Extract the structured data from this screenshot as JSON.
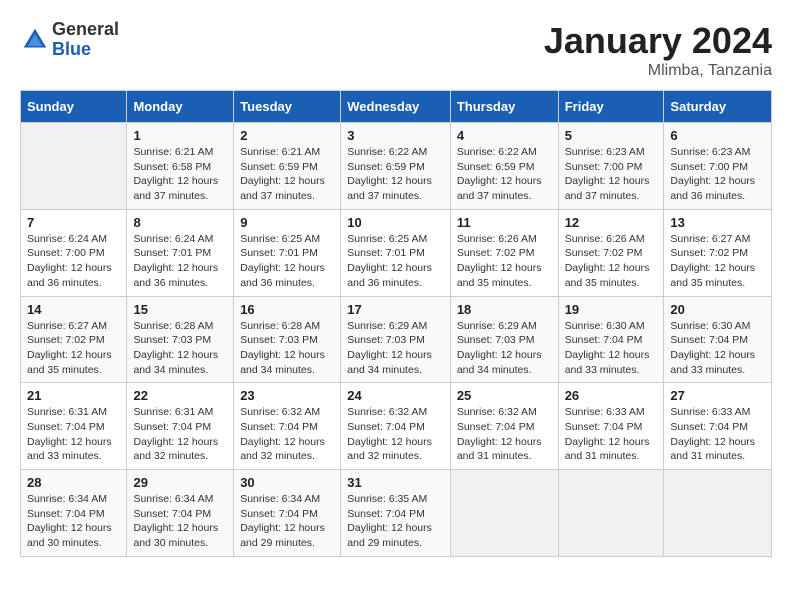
{
  "logo": {
    "general": "General",
    "blue": "Blue"
  },
  "title": {
    "month_year": "January 2024",
    "location": "Mlimba, Tanzania"
  },
  "calendar": {
    "headers": [
      "Sunday",
      "Monday",
      "Tuesday",
      "Wednesday",
      "Thursday",
      "Friday",
      "Saturday"
    ],
    "weeks": [
      [
        {
          "day": "",
          "sunrise": "",
          "sunset": "",
          "daylight": ""
        },
        {
          "day": "1",
          "sunrise": "Sunrise: 6:21 AM",
          "sunset": "Sunset: 6:58 PM",
          "daylight": "Daylight: 12 hours and 37 minutes."
        },
        {
          "day": "2",
          "sunrise": "Sunrise: 6:21 AM",
          "sunset": "Sunset: 6:59 PM",
          "daylight": "Daylight: 12 hours and 37 minutes."
        },
        {
          "day": "3",
          "sunrise": "Sunrise: 6:22 AM",
          "sunset": "Sunset: 6:59 PM",
          "daylight": "Daylight: 12 hours and 37 minutes."
        },
        {
          "day": "4",
          "sunrise": "Sunrise: 6:22 AM",
          "sunset": "Sunset: 6:59 PM",
          "daylight": "Daylight: 12 hours and 37 minutes."
        },
        {
          "day": "5",
          "sunrise": "Sunrise: 6:23 AM",
          "sunset": "Sunset: 7:00 PM",
          "daylight": "Daylight: 12 hours and 37 minutes."
        },
        {
          "day": "6",
          "sunrise": "Sunrise: 6:23 AM",
          "sunset": "Sunset: 7:00 PM",
          "daylight": "Daylight: 12 hours and 36 minutes."
        }
      ],
      [
        {
          "day": "7",
          "sunrise": "Sunrise: 6:24 AM",
          "sunset": "Sunset: 7:00 PM",
          "daylight": "Daylight: 12 hours and 36 minutes."
        },
        {
          "day": "8",
          "sunrise": "Sunrise: 6:24 AM",
          "sunset": "Sunset: 7:01 PM",
          "daylight": "Daylight: 12 hours and 36 minutes."
        },
        {
          "day": "9",
          "sunrise": "Sunrise: 6:25 AM",
          "sunset": "Sunset: 7:01 PM",
          "daylight": "Daylight: 12 hours and 36 minutes."
        },
        {
          "day": "10",
          "sunrise": "Sunrise: 6:25 AM",
          "sunset": "Sunset: 7:01 PM",
          "daylight": "Daylight: 12 hours and 36 minutes."
        },
        {
          "day": "11",
          "sunrise": "Sunrise: 6:26 AM",
          "sunset": "Sunset: 7:02 PM",
          "daylight": "Daylight: 12 hours and 35 minutes."
        },
        {
          "day": "12",
          "sunrise": "Sunrise: 6:26 AM",
          "sunset": "Sunset: 7:02 PM",
          "daylight": "Daylight: 12 hours and 35 minutes."
        },
        {
          "day": "13",
          "sunrise": "Sunrise: 6:27 AM",
          "sunset": "Sunset: 7:02 PM",
          "daylight": "Daylight: 12 hours and 35 minutes."
        }
      ],
      [
        {
          "day": "14",
          "sunrise": "Sunrise: 6:27 AM",
          "sunset": "Sunset: 7:02 PM",
          "daylight": "Daylight: 12 hours and 35 minutes."
        },
        {
          "day": "15",
          "sunrise": "Sunrise: 6:28 AM",
          "sunset": "Sunset: 7:03 PM",
          "daylight": "Daylight: 12 hours and 34 minutes."
        },
        {
          "day": "16",
          "sunrise": "Sunrise: 6:28 AM",
          "sunset": "Sunset: 7:03 PM",
          "daylight": "Daylight: 12 hours and 34 minutes."
        },
        {
          "day": "17",
          "sunrise": "Sunrise: 6:29 AM",
          "sunset": "Sunset: 7:03 PM",
          "daylight": "Daylight: 12 hours and 34 minutes."
        },
        {
          "day": "18",
          "sunrise": "Sunrise: 6:29 AM",
          "sunset": "Sunset: 7:03 PM",
          "daylight": "Daylight: 12 hours and 34 minutes."
        },
        {
          "day": "19",
          "sunrise": "Sunrise: 6:30 AM",
          "sunset": "Sunset: 7:04 PM",
          "daylight": "Daylight: 12 hours and 33 minutes."
        },
        {
          "day": "20",
          "sunrise": "Sunrise: 6:30 AM",
          "sunset": "Sunset: 7:04 PM",
          "daylight": "Daylight: 12 hours and 33 minutes."
        }
      ],
      [
        {
          "day": "21",
          "sunrise": "Sunrise: 6:31 AM",
          "sunset": "Sunset: 7:04 PM",
          "daylight": "Daylight: 12 hours and 33 minutes."
        },
        {
          "day": "22",
          "sunrise": "Sunrise: 6:31 AM",
          "sunset": "Sunset: 7:04 PM",
          "daylight": "Daylight: 12 hours and 32 minutes."
        },
        {
          "day": "23",
          "sunrise": "Sunrise: 6:32 AM",
          "sunset": "Sunset: 7:04 PM",
          "daylight": "Daylight: 12 hours and 32 minutes."
        },
        {
          "day": "24",
          "sunrise": "Sunrise: 6:32 AM",
          "sunset": "Sunset: 7:04 PM",
          "daylight": "Daylight: 12 hours and 32 minutes."
        },
        {
          "day": "25",
          "sunrise": "Sunrise: 6:32 AM",
          "sunset": "Sunset: 7:04 PM",
          "daylight": "Daylight: 12 hours and 31 minutes."
        },
        {
          "day": "26",
          "sunrise": "Sunrise: 6:33 AM",
          "sunset": "Sunset: 7:04 PM",
          "daylight": "Daylight: 12 hours and 31 minutes."
        },
        {
          "day": "27",
          "sunrise": "Sunrise: 6:33 AM",
          "sunset": "Sunset: 7:04 PM",
          "daylight": "Daylight: 12 hours and 31 minutes."
        }
      ],
      [
        {
          "day": "28",
          "sunrise": "Sunrise: 6:34 AM",
          "sunset": "Sunset: 7:04 PM",
          "daylight": "Daylight: 12 hours and 30 minutes."
        },
        {
          "day": "29",
          "sunrise": "Sunrise: 6:34 AM",
          "sunset": "Sunset: 7:04 PM",
          "daylight": "Daylight: 12 hours and 30 minutes."
        },
        {
          "day": "30",
          "sunrise": "Sunrise: 6:34 AM",
          "sunset": "Sunset: 7:04 PM",
          "daylight": "Daylight: 12 hours and 29 minutes."
        },
        {
          "day": "31",
          "sunrise": "Sunrise: 6:35 AM",
          "sunset": "Sunset: 7:04 PM",
          "daylight": "Daylight: 12 hours and 29 minutes."
        },
        {
          "day": "",
          "sunrise": "",
          "sunset": "",
          "daylight": ""
        },
        {
          "day": "",
          "sunrise": "",
          "sunset": "",
          "daylight": ""
        },
        {
          "day": "",
          "sunrise": "",
          "sunset": "",
          "daylight": ""
        }
      ]
    ]
  }
}
